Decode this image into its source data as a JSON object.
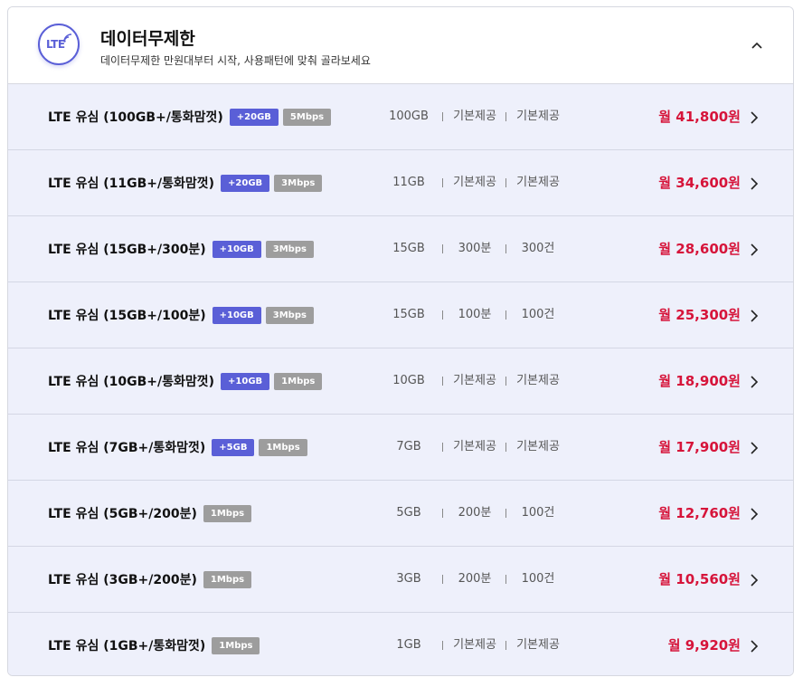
{
  "header": {
    "title": "데이터무제한",
    "subtitle": "데이터무제한 만원대부터 시작, 사용패턴에 맞춰 골라보세요",
    "badge_text": "LTE",
    "accent_color": "#5a5fd7"
  },
  "colors": {
    "price": "#d6143a",
    "bonus_chip": "#5a5fd7",
    "speed_chip": "#9d9d9d",
    "row_bg": "#eef0fb"
  },
  "plans": [
    {
      "name": "LTE 유심 (100GB+/통화맘껏)",
      "bonus": "+20GB",
      "speed": "5Mbps",
      "data": "100GB",
      "voice": "기본제공",
      "sms": "기본제공",
      "price": "월 41,800원"
    },
    {
      "name": "LTE 유심 (11GB+/통화맘껏)",
      "bonus": "+20GB",
      "speed": "3Mbps",
      "data": "11GB",
      "voice": "기본제공",
      "sms": "기본제공",
      "price": "월 34,600원"
    },
    {
      "name": "LTE 유심 (15GB+/300분)",
      "bonus": "+10GB",
      "speed": "3Mbps",
      "data": "15GB",
      "voice": "300분",
      "sms": "300건",
      "price": "월 28,600원"
    },
    {
      "name": "LTE 유심 (15GB+/100분)",
      "bonus": "+10GB",
      "speed": "3Mbps",
      "data": "15GB",
      "voice": "100분",
      "sms": "100건",
      "price": "월 25,300원"
    },
    {
      "name": "LTE 유심 (10GB+/통화맘껏)",
      "bonus": "+10GB",
      "speed": "1Mbps",
      "data": "10GB",
      "voice": "기본제공",
      "sms": "기본제공",
      "price": "월 18,900원"
    },
    {
      "name": "LTE 유심 (7GB+/통화맘껏)",
      "bonus": "+5GB",
      "speed": "1Mbps",
      "data": "7GB",
      "voice": "기본제공",
      "sms": "기본제공",
      "price": "월 17,900원"
    },
    {
      "name": "LTE 유심 (5GB+/200분)",
      "bonus": "",
      "speed": "1Mbps",
      "data": "5GB",
      "voice": "200분",
      "sms": "100건",
      "price": "월 12,760원"
    },
    {
      "name": "LTE 유심 (3GB+/200분)",
      "bonus": "",
      "speed": "1Mbps",
      "data": "3GB",
      "voice": "200분",
      "sms": "100건",
      "price": "월 10,560원"
    },
    {
      "name": "LTE 유심 (1GB+/통화맘껏)",
      "bonus": "",
      "speed": "1Mbps",
      "data": "1GB",
      "voice": "기본제공",
      "sms": "기본제공",
      "price": "월 9,920원"
    }
  ]
}
